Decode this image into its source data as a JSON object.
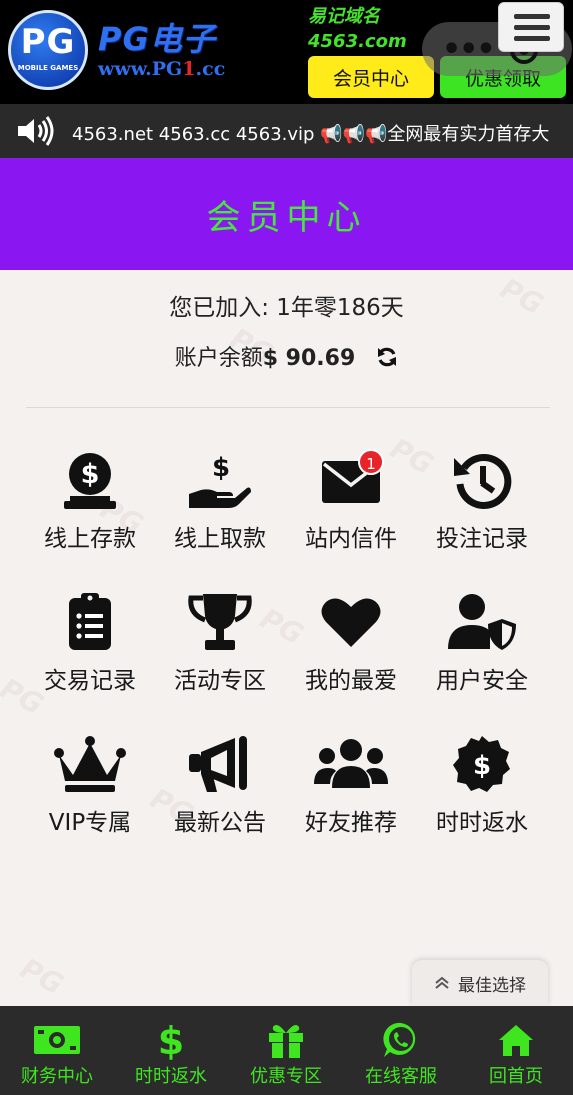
{
  "header": {
    "logo_text": "PG",
    "logo_subtext": "MOBILE GAMES",
    "brand_title": "PG电子",
    "brand_url_prefix": "www.PG",
    "brand_url_highlight": "1",
    "brand_url_suffix": ".cc",
    "domain_note_line1": "易记域名",
    "domain_note_line2": "4563.com",
    "member_button": "会员中心",
    "promo_button": "优惠领取"
  },
  "marquee": {
    "text": "4563.net 4563.cc 4563.vip 📢📢📢全网最有实力首存大"
  },
  "banner": {
    "title": "会员中心"
  },
  "account": {
    "joined_label": "您已加入: ",
    "joined_value": "1年零186天",
    "balance_label": "账户余额",
    "balance_value": "$ 90.69"
  },
  "grid": [
    {
      "label": "线上存款",
      "icon": "coin-deposit-icon"
    },
    {
      "label": "线上取款",
      "icon": "hand-dollar-icon"
    },
    {
      "label": "站内信件",
      "icon": "envelope-icon",
      "badge": "1"
    },
    {
      "label": "投注记录",
      "icon": "history-icon"
    },
    {
      "label": "交易记录",
      "icon": "clipboard-list-icon"
    },
    {
      "label": "活动专区",
      "icon": "trophy-icon"
    },
    {
      "label": "我的最爱",
      "icon": "heart-icon"
    },
    {
      "label": "用户安全",
      "icon": "user-shield-icon"
    },
    {
      "label": "VIP专属",
      "icon": "crown-icon"
    },
    {
      "label": "最新公告",
      "icon": "megaphone-icon"
    },
    {
      "label": "好友推荐",
      "icon": "users-icon"
    },
    {
      "label": "时时返水",
      "icon": "dollar-badge-icon"
    }
  ],
  "chip": {
    "label": "最佳选择"
  },
  "bottom_nav": [
    {
      "label": "财务中心",
      "icon": "money-bill-icon"
    },
    {
      "label": "时时返水",
      "icon": "dollar-icon"
    },
    {
      "label": "优惠专区",
      "icon": "gift-icon"
    },
    {
      "label": "在线客服",
      "icon": "whatsapp-icon"
    },
    {
      "label": "回首页",
      "icon": "home-icon"
    }
  ],
  "colors": {
    "header_bg": "#000000",
    "banner_bg": "#8a16f2",
    "banner_text": "#47e63a",
    "member_btn": "#ffeb1a",
    "promo_btn": "#3ce422",
    "nav_bg": "#2b2b2b",
    "nav_accent": "#3fe61f",
    "badge_red": "#e8232a"
  }
}
